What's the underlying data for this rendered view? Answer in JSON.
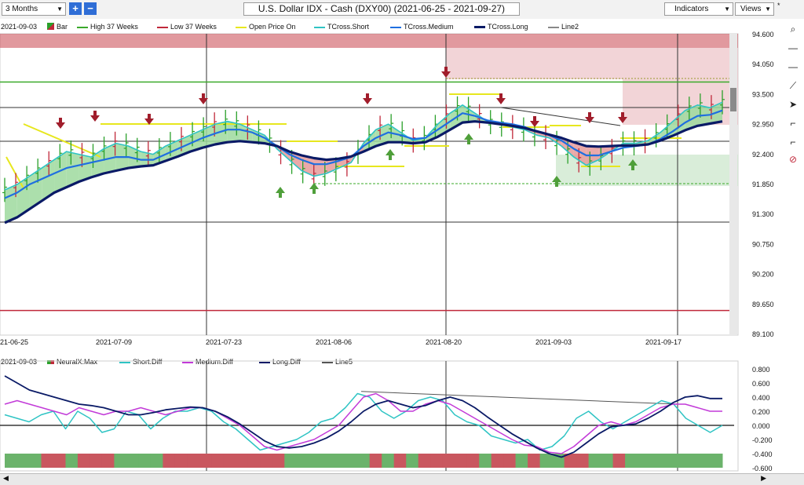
{
  "toolbar": {
    "range_select": "3 Months",
    "zoom_in": "+",
    "zoom_out": "−",
    "title": "U.S. Dollar IDX - Cash (DXY00) (2021-06-25 - 2021-09-27)",
    "indicators": "Indicators",
    "views": "Views",
    "star": "*"
  },
  "sidebar": {
    "icons": [
      "magnify-icon",
      "horizontal-line-icon",
      "horizontal-line-icon",
      "draw-line-icon",
      "cursor-icon",
      "step-icon",
      "step-icon",
      "delete-icon"
    ]
  },
  "legend_main": {
    "date": "2021-09-03",
    "bar": "Bar",
    "high": "High 37 Weeks",
    "low": "Low 37 Weeks",
    "open": "Open Price On",
    "tshort": "TCross.Short",
    "tmed": "TCross.Medium",
    "tlong": "TCross.Long",
    "line2": "Line2"
  },
  "legend_osc": {
    "date": "2021-09-03",
    "neuralx": "NeuralX.Max",
    "short": "Short.Diff",
    "medium": "Medium.Diff",
    "long": "Long.Diff",
    "line5": "Line5"
  },
  "chart_data": [
    {
      "type": "line",
      "title": "U.S. Dollar IDX - Cash (DXY00) (2021-06-25 - 2021-09-27)",
      "x_tick_labels": [
        "21-06-25",
        "2021-07-09",
        "2021-07-23",
        "2021-08-06",
        "2021-08-20",
        "2021-09-03",
        "2021-09-17"
      ],
      "y_tick_labels": [
        "94.600",
        "94.050",
        "93.500",
        "92.950",
        "92.400",
        "91.850",
        "91.300",
        "90.750",
        "90.200",
        "89.650",
        "89.100"
      ],
      "ylim": [
        89.1,
        94.6
      ],
      "high_37_weeks": 93.72,
      "low_37_weeks": 89.55,
      "series": [
        {
          "name": "TCross.Short",
          "color": "#2fc4c4",
          "values": [
            91.75,
            91.85,
            92.0,
            92.15,
            92.3,
            92.45,
            92.4,
            92.35,
            92.5,
            92.6,
            92.55,
            92.45,
            92.4,
            92.55,
            92.65,
            92.75,
            92.85,
            92.95,
            93.0,
            92.95,
            92.85,
            92.75,
            92.5,
            92.3,
            92.1,
            92.0,
            92.05,
            92.15,
            92.25,
            92.6,
            92.85,
            92.95,
            92.8,
            92.65,
            92.7,
            92.95,
            93.15,
            93.3,
            93.15,
            93.0,
            92.95,
            92.9,
            92.85,
            92.75,
            92.7,
            92.55,
            92.35,
            92.2,
            92.3,
            92.45,
            92.6,
            92.6,
            92.65,
            92.8,
            93.0,
            93.2,
            93.3,
            93.25,
            93.35
          ]
        },
        {
          "name": "TCross.Medium",
          "color": "#1f6fe0",
          "values": [
            91.6,
            91.7,
            91.85,
            91.95,
            92.05,
            92.15,
            92.2,
            92.25,
            92.3,
            92.35,
            92.35,
            92.3,
            92.3,
            92.4,
            92.5,
            92.6,
            92.7,
            92.78,
            92.85,
            92.85,
            92.8,
            92.7,
            92.55,
            92.4,
            92.3,
            92.22,
            92.22,
            92.28,
            92.35,
            92.55,
            92.7,
            92.8,
            92.75,
            92.68,
            92.7,
            92.85,
            93.0,
            93.15,
            93.1,
            93.02,
            92.98,
            92.95,
            92.9,
            92.82,
            92.75,
            92.65,
            92.5,
            92.38,
            92.38,
            92.45,
            92.52,
            92.55,
            92.58,
            92.68,
            92.82,
            92.98,
            93.1,
            93.12,
            93.2
          ]
        },
        {
          "name": "TCross.Long",
          "color": "#0a1a66",
          "values": [
            91.15,
            91.25,
            91.4,
            91.55,
            91.7,
            91.8,
            91.9,
            91.98,
            92.05,
            92.1,
            92.15,
            92.18,
            92.2,
            92.28,
            92.36,
            92.45,
            92.52,
            92.58,
            92.62,
            92.64,
            92.62,
            92.6,
            92.55,
            92.45,
            92.38,
            92.33,
            92.3,
            92.32,
            92.36,
            92.45,
            92.55,
            92.62,
            92.62,
            92.6,
            92.62,
            92.72,
            92.85,
            92.98,
            93.0,
            92.98,
            92.95,
            92.92,
            92.88,
            92.82,
            92.76,
            92.7,
            92.62,
            92.55,
            92.54,
            92.55,
            92.56,
            92.56,
            92.58,
            92.65,
            92.74,
            92.84,
            92.92,
            92.96,
            93.0
          ]
        }
      ]
    },
    {
      "type": "line",
      "y_tick_labels": [
        "0.800",
        "0.600",
        "0.400",
        "0.200",
        "0.000",
        "-0.200",
        "-0.400",
        "-0.600"
      ],
      "ylim": [
        -0.6,
        0.8
      ],
      "series": [
        {
          "name": "Short.Diff",
          "color": "#2fc4c4",
          "values": [
            0.15,
            0.1,
            0.05,
            0.15,
            0.2,
            -0.05,
            0.2,
            0.1,
            -0.1,
            -0.05,
            0.2,
            0.15,
            -0.05,
            0.1,
            0.2,
            0.2,
            0.25,
            0.2,
            0.05,
            -0.05,
            -0.2,
            -0.35,
            -0.3,
            -0.25,
            -0.2,
            -0.1,
            0.05,
            0.1,
            0.25,
            0.45,
            0.4,
            0.2,
            0.1,
            0.2,
            0.35,
            0.4,
            0.35,
            0.15,
            0.05,
            0.0,
            -0.15,
            -0.2,
            -0.25,
            -0.2,
            -0.35,
            -0.3,
            -0.15,
            0.1,
            0.2,
            0.05,
            -0.05,
            0.05,
            0.15,
            0.25,
            0.35,
            0.3,
            0.1,
            0.0,
            -0.1,
            0.0
          ]
        },
        {
          "name": "Medium.Diff",
          "color": "#c23ad8",
          "values": [
            0.3,
            0.35,
            0.3,
            0.25,
            0.2,
            0.15,
            0.25,
            0.2,
            0.15,
            0.2,
            0.2,
            0.25,
            0.2,
            0.15,
            0.2,
            0.25,
            0.25,
            0.2,
            0.1,
            0.0,
            -0.15,
            -0.3,
            -0.35,
            -0.3,
            -0.25,
            -0.2,
            -0.1,
            0.0,
            0.2,
            0.4,
            0.45,
            0.35,
            0.2,
            0.2,
            0.3,
            0.35,
            0.3,
            0.2,
            0.1,
            0.0,
            -0.1,
            -0.2,
            -0.28,
            -0.3,
            -0.38,
            -0.4,
            -0.3,
            -0.15,
            0.0,
            0.05,
            0.0,
            0.05,
            0.15,
            0.25,
            0.3,
            0.3,
            0.25,
            0.2,
            0.2
          ]
        },
        {
          "name": "Long.Diff",
          "color": "#0a1a66",
          "values": [
            0.7,
            0.6,
            0.5,
            0.45,
            0.4,
            0.35,
            0.3,
            0.28,
            0.25,
            0.2,
            0.15,
            0.15,
            0.18,
            0.22,
            0.24,
            0.26,
            0.25,
            0.2,
            0.12,
            0.02,
            -0.1,
            -0.22,
            -0.3,
            -0.32,
            -0.3,
            -0.25,
            -0.18,
            -0.08,
            0.05,
            0.2,
            0.3,
            0.35,
            0.3,
            0.25,
            0.28,
            0.35,
            0.4,
            0.35,
            0.25,
            0.12,
            0.0,
            -0.12,
            -0.22,
            -0.32,
            -0.4,
            -0.45,
            -0.38,
            -0.25,
            -0.12,
            -0.02,
            0.0,
            0.02,
            0.1,
            0.2,
            0.32,
            0.4,
            0.42,
            0.38,
            0.38
          ]
        },
        {
          "name": "Line5",
          "color": "#555555",
          "values": [
            0.45,
            0.3
          ]
        }
      ],
      "neuralx_colors": [
        "g",
        "g",
        "g",
        "r",
        "r",
        "g",
        "r",
        "r",
        "r",
        "g",
        "g",
        "g",
        "g",
        "r",
        "r",
        "r",
        "r",
        "r",
        "r",
        "r",
        "r",
        "r",
        "r",
        "g",
        "g",
        "g",
        "g",
        "g",
        "g",
        "g",
        "r",
        "g",
        "r",
        "g",
        "r",
        "r",
        "r",
        "r",
        "r",
        "g",
        "r",
        "r",
        "g",
        "r",
        "g",
        "g",
        "r",
        "r",
        "g",
        "g",
        "r",
        "g",
        "g",
        "g",
        "g",
        "g",
        "g",
        "g",
        "g"
      ]
    }
  ]
}
